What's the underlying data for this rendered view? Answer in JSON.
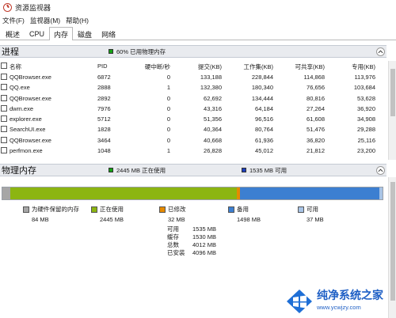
{
  "window": {
    "title": "资源监视器"
  },
  "menu": {
    "items": [
      "文件(F)",
      "监视器(M)",
      "帮助(H)"
    ]
  },
  "tabs": [
    "概述",
    "CPU",
    "内存",
    "磁盘",
    "网络"
  ],
  "processes": {
    "title": "进程",
    "summary": "60% 已用物理内存",
    "summary_color": "#15a315",
    "columns": {
      "name": "名称",
      "pid": "PID",
      "hard_faults": "硬中断/秒",
      "commit": "提交(KB)",
      "working_set": "工作集(KB)",
      "shareable": "可共享(KB)",
      "private": "专用(KB)"
    },
    "rows": [
      {
        "name": "QQBrowser.exe",
        "pid": "6872",
        "hard_faults": "0",
        "commit": "133,188",
        "working_set": "228,844",
        "shareable": "114,868",
        "private": "113,976"
      },
      {
        "name": "QQ.exe",
        "pid": "2888",
        "hard_faults": "1",
        "commit": "132,380",
        "working_set": "180,340",
        "shareable": "76,656",
        "private": "103,684"
      },
      {
        "name": "QQBrowser.exe",
        "pid": "2892",
        "hard_faults": "0",
        "commit": "62,692",
        "working_set": "134,444",
        "shareable": "80,816",
        "private": "53,628"
      },
      {
        "name": "dwm.exe",
        "pid": "7976",
        "hard_faults": "0",
        "commit": "43,316",
        "working_set": "64,184",
        "shareable": "27,264",
        "private": "36,920"
      },
      {
        "name": "explorer.exe",
        "pid": "5712",
        "hard_faults": "0",
        "commit": "51,356",
        "working_set": "96,516",
        "shareable": "61,608",
        "private": "34,908"
      },
      {
        "name": "SearchUI.exe",
        "pid": "1828",
        "hard_faults": "0",
        "commit": "40,364",
        "working_set": "80,764",
        "shareable": "51,476",
        "private": "29,288"
      },
      {
        "name": "QQBrowser.exe",
        "pid": "3464",
        "hard_faults": "0",
        "commit": "40,668",
        "working_set": "61,936",
        "shareable": "36,820",
        "private": "25,116"
      },
      {
        "name": "perfmon.exe",
        "pid": "1048",
        "hard_faults": "1",
        "commit": "26,828",
        "working_set": "45,012",
        "shareable": "21,812",
        "private": "23,200"
      }
    ]
  },
  "physical_memory": {
    "title": "物理内存",
    "in_use_summary": "2445 MB 正在使用",
    "available_summary": "1535 MB 可用",
    "bar": [
      {
        "key": "hardware",
        "mb": 84,
        "color": "#a6a6a6"
      },
      {
        "key": "in_use",
        "mb": 2445,
        "color": "#8cb511"
      },
      {
        "key": "modified",
        "mb": 32,
        "color": "#e68a00"
      },
      {
        "key": "standby",
        "mb": 1498,
        "color": "#3c7fd1"
      },
      {
        "key": "free",
        "mb": 37,
        "color": "#a8c4e6"
      }
    ],
    "legend": [
      {
        "label": "为硬件保留的内存",
        "value": "84 MB",
        "color": "#a6a6a6"
      },
      {
        "label": "正在使用",
        "value": "2445 MB",
        "color": "#8cb511"
      },
      {
        "label": "已修改",
        "value": "32 MB",
        "color": "#e68a00"
      },
      {
        "label": "备用",
        "value": "1498 MB",
        "color": "#3c7fd1"
      },
      {
        "label": "可用",
        "value": "37 MB",
        "color": "#a8c4e6"
      }
    ],
    "stats": [
      {
        "label": "可用",
        "value": "1535 MB"
      },
      {
        "label": "缓存",
        "value": "1530 MB"
      },
      {
        "label": "总数",
        "value": "4012 MB"
      },
      {
        "label": "已安装",
        "value": "4096 MB"
      }
    ]
  },
  "watermark": {
    "text": "纯净系统之家",
    "url": "www.ycwjzy.com"
  }
}
